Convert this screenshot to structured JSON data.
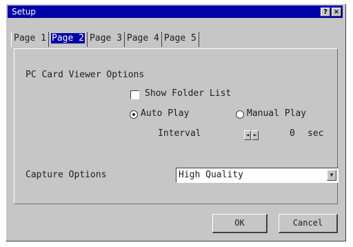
{
  "window": {
    "title": "Setup",
    "help_btn": "?",
    "close_btn": "×"
  },
  "tabs": [
    {
      "label": "Page 1",
      "active": false
    },
    {
      "label": "Page 2",
      "active": true
    },
    {
      "label": "Page 3",
      "active": false
    },
    {
      "label": "Page 4",
      "active": false
    },
    {
      "label": "Page 5",
      "active": false
    }
  ],
  "pc_card": {
    "section_label": "PC Card Viewer Options",
    "show_folder_list": {
      "label": "Show Folder List",
      "checked": false
    },
    "auto_play": {
      "label": "Auto Play",
      "selected": true
    },
    "manual_play": {
      "label": "Manual Play",
      "selected": false
    },
    "interval": {
      "label": "Interval",
      "value": "0",
      "unit": "sec"
    }
  },
  "capture": {
    "label": "Capture Options",
    "value": "High Quality"
  },
  "buttons": {
    "ok": "OK",
    "cancel": "Cancel"
  },
  "icons": {
    "spin_left": "◄",
    "spin_right": "►",
    "dropdown": "▼"
  },
  "colors": {
    "titlebar": "#0000a8",
    "face": "#c6c6c6"
  }
}
